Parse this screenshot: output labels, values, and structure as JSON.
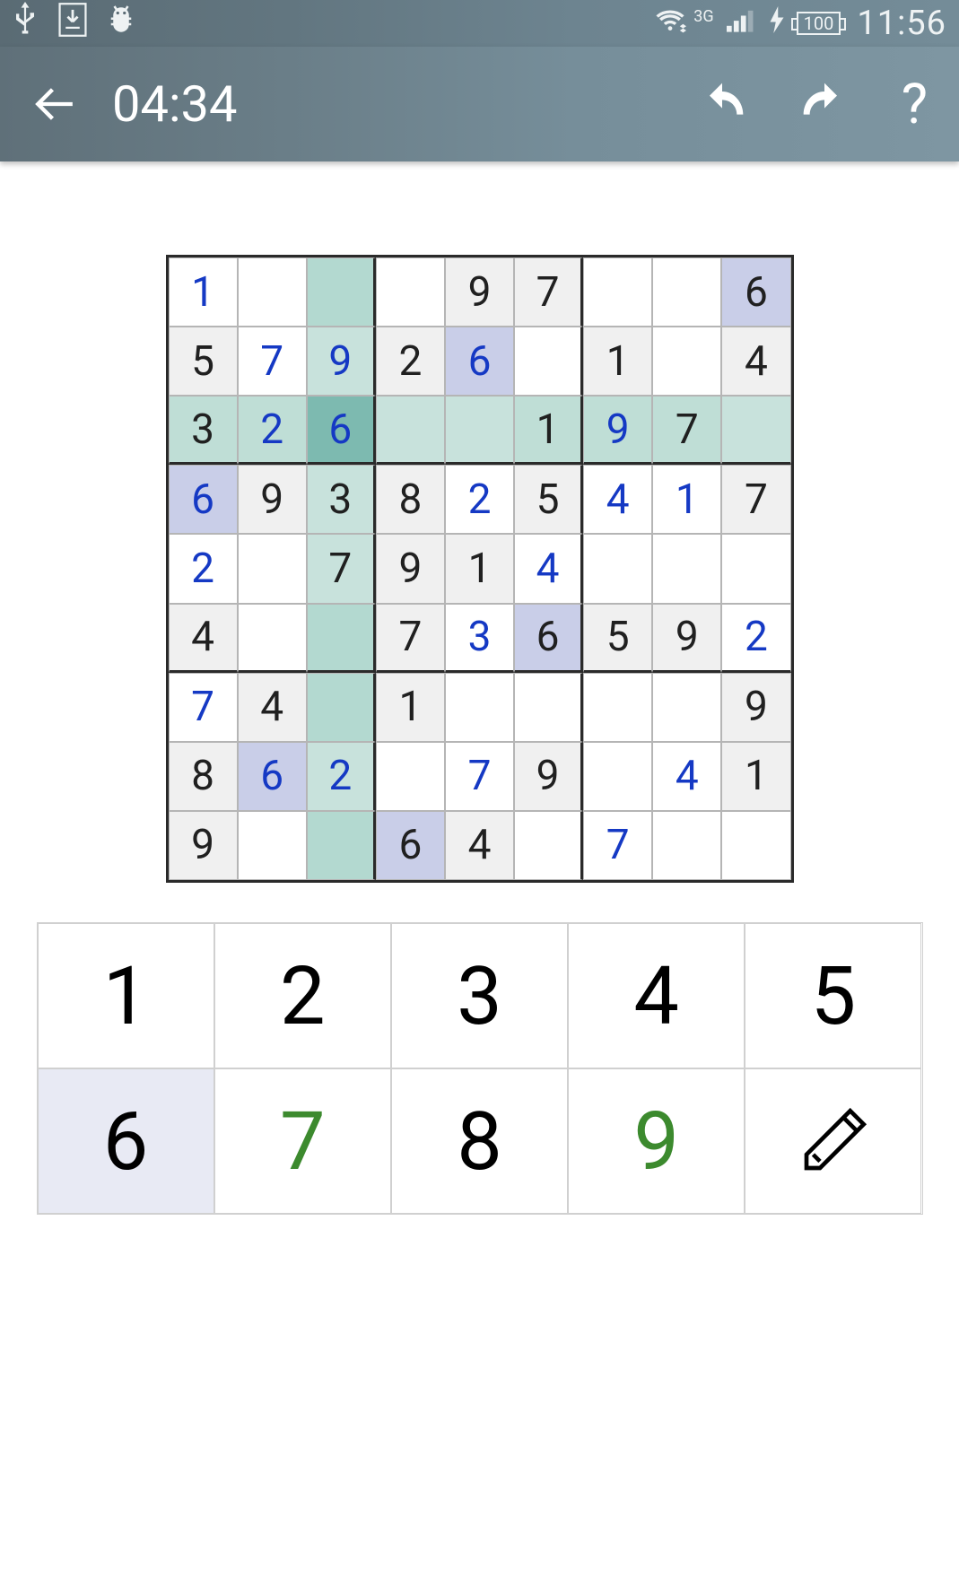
{
  "status_bar": {
    "network_label": "3G",
    "battery_level": "100",
    "time": "11:56"
  },
  "toolbar": {
    "elapsed_time": "04:34",
    "help_label": "?"
  },
  "sudoku": {
    "selected": {
      "row": 2,
      "col": 2
    },
    "cells": [
      [
        {
          "v": "1",
          "t": "user"
        },
        {
          "v": "",
          "t": ""
        },
        {
          "v": "",
          "t": "",
          "hl": "col-med"
        },
        {
          "v": "",
          "t": ""
        },
        {
          "v": "9",
          "t": "given"
        },
        {
          "v": "7",
          "t": "given"
        },
        {
          "v": "",
          "t": ""
        },
        {
          "v": "",
          "t": ""
        },
        {
          "v": "6",
          "t": "given",
          "hl": "same-blue"
        }
      ],
      [
        {
          "v": "5",
          "t": "given"
        },
        {
          "v": "7",
          "t": "user"
        },
        {
          "v": "9",
          "t": "user",
          "hl": "col-light"
        },
        {
          "v": "2",
          "t": "given"
        },
        {
          "v": "6",
          "t": "user",
          "hl": "same-blue"
        },
        {
          "v": "",
          "t": ""
        },
        {
          "v": "1",
          "t": "given"
        },
        {
          "v": "",
          "t": ""
        },
        {
          "v": "4",
          "t": "given"
        }
      ],
      [
        {
          "v": "3",
          "t": "given",
          "hl": "row"
        },
        {
          "v": "2",
          "t": "user",
          "hl": "row"
        },
        {
          "v": "6",
          "t": "user",
          "hl": "selected"
        },
        {
          "v": "",
          "t": "",
          "hl": "row-empty"
        },
        {
          "v": "",
          "t": "",
          "hl": "row-empty"
        },
        {
          "v": "1",
          "t": "given",
          "hl": "row"
        },
        {
          "v": "9",
          "t": "user",
          "hl": "row"
        },
        {
          "v": "7",
          "t": "given",
          "hl": "row"
        },
        {
          "v": "",
          "t": "",
          "hl": "row-empty"
        }
      ],
      [
        {
          "v": "6",
          "t": "user",
          "hl": "same-blue"
        },
        {
          "v": "9",
          "t": "given"
        },
        {
          "v": "3",
          "t": "given",
          "hl": "col-light"
        },
        {
          "v": "8",
          "t": "given"
        },
        {
          "v": "2",
          "t": "user"
        },
        {
          "v": "5",
          "t": "given"
        },
        {
          "v": "4",
          "t": "user"
        },
        {
          "v": "1",
          "t": "user"
        },
        {
          "v": "7",
          "t": "given"
        }
      ],
      [
        {
          "v": "2",
          "t": "user"
        },
        {
          "v": "",
          "t": ""
        },
        {
          "v": "7",
          "t": "given",
          "hl": "col-light"
        },
        {
          "v": "9",
          "t": "given"
        },
        {
          "v": "1",
          "t": "given"
        },
        {
          "v": "4",
          "t": "user"
        },
        {
          "v": "",
          "t": ""
        },
        {
          "v": "",
          "t": ""
        },
        {
          "v": "",
          "t": ""
        }
      ],
      [
        {
          "v": "4",
          "t": "given"
        },
        {
          "v": "",
          "t": ""
        },
        {
          "v": "",
          "t": "",
          "hl": "col-med"
        },
        {
          "v": "7",
          "t": "given"
        },
        {
          "v": "3",
          "t": "user"
        },
        {
          "v": "6",
          "t": "given",
          "hl": "same-blue"
        },
        {
          "v": "5",
          "t": "given"
        },
        {
          "v": "9",
          "t": "given"
        },
        {
          "v": "2",
          "t": "user"
        }
      ],
      [
        {
          "v": "7",
          "t": "user"
        },
        {
          "v": "4",
          "t": "given"
        },
        {
          "v": "",
          "t": "",
          "hl": "col-med"
        },
        {
          "v": "1",
          "t": "given"
        },
        {
          "v": "",
          "t": ""
        },
        {
          "v": "",
          "t": ""
        },
        {
          "v": "",
          "t": ""
        },
        {
          "v": "",
          "t": ""
        },
        {
          "v": "9",
          "t": "given"
        }
      ],
      [
        {
          "v": "8",
          "t": "given"
        },
        {
          "v": "6",
          "t": "user",
          "hl": "same-blue"
        },
        {
          "v": "2",
          "t": "user",
          "hl": "col-light"
        },
        {
          "v": "",
          "t": ""
        },
        {
          "v": "7",
          "t": "user"
        },
        {
          "v": "9",
          "t": "given"
        },
        {
          "v": "",
          "t": ""
        },
        {
          "v": "4",
          "t": "user"
        },
        {
          "v": "1",
          "t": "given"
        }
      ],
      [
        {
          "v": "9",
          "t": "given"
        },
        {
          "v": "",
          "t": ""
        },
        {
          "v": "",
          "t": "",
          "hl": "col-med"
        },
        {
          "v": "6",
          "t": "given",
          "hl": "same-blue"
        },
        {
          "v": "4",
          "t": "given"
        },
        {
          "v": "",
          "t": ""
        },
        {
          "v": "7",
          "t": "user"
        },
        {
          "v": "",
          "t": ""
        },
        {
          "v": "",
          "t": ""
        }
      ]
    ]
  },
  "numpad": {
    "buttons": [
      {
        "label": "1",
        "kind": "num"
      },
      {
        "label": "2",
        "kind": "num"
      },
      {
        "label": "3",
        "kind": "num"
      },
      {
        "label": "4",
        "kind": "num"
      },
      {
        "label": "5",
        "kind": "num"
      },
      {
        "label": "6",
        "kind": "num",
        "selected": true
      },
      {
        "label": "7",
        "kind": "num",
        "green": true
      },
      {
        "label": "8",
        "kind": "num"
      },
      {
        "label": "9",
        "kind": "num",
        "green": true
      },
      {
        "label": "",
        "kind": "pencil"
      }
    ]
  }
}
